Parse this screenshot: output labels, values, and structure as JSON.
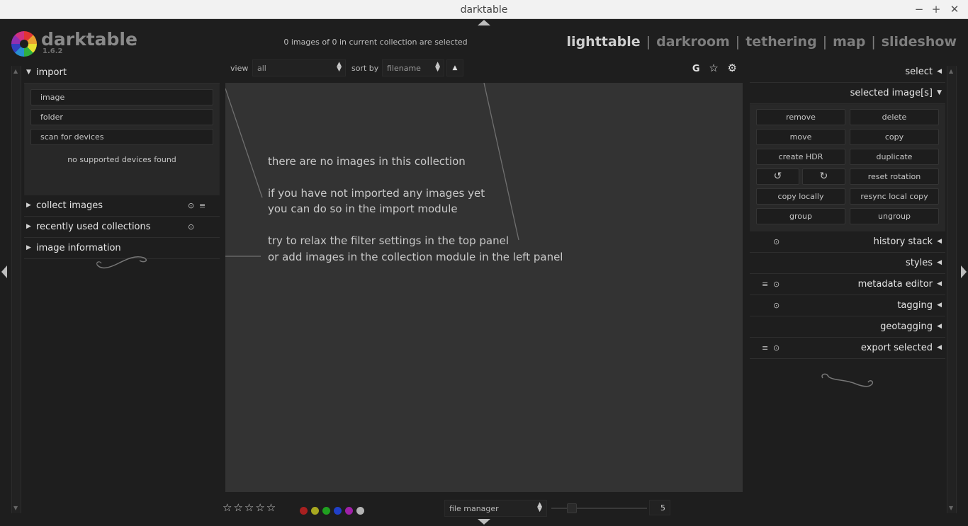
{
  "window": {
    "title": "darktable",
    "minimize": "−",
    "maximize": "+",
    "close": "✕"
  },
  "header": {
    "app_name": "darktable",
    "version": "1.6.2",
    "selection_info": "0 images of 0 in current collection are selected",
    "views": [
      "lighttable",
      "darkroom",
      "tethering",
      "map",
      "slideshow"
    ],
    "view_separator": "|",
    "active_view": "lighttable"
  },
  "left_panel": {
    "import": {
      "label": "import",
      "buttons": [
        "image",
        "folder",
        "scan for devices"
      ],
      "status": "no supported devices found"
    },
    "modules": [
      {
        "label": "collect images",
        "icons": [
          "⊙",
          "≡"
        ]
      },
      {
        "label": "recently used collections",
        "icons": [
          "⊙"
        ]
      },
      {
        "label": "image information",
        "icons": []
      }
    ]
  },
  "top_bar": {
    "view_label": "view",
    "view_value": "all",
    "sort_label": "sort by",
    "sort_value": "filename",
    "sort_direction": "▲",
    "icons": {
      "grouping": "G",
      "overlays": "☆",
      "preferences": "⚙"
    }
  },
  "center": {
    "messages": [
      "there are no images in this collection",
      "if you have not imported any images yet",
      "you can do so in the import module",
      "try to relax the filter settings in the top panel",
      "or add images in the collection module in the left panel"
    ]
  },
  "bottom_bar": {
    "stars": "☆☆☆☆☆",
    "color_labels": [
      "#a82020",
      "#a8a820",
      "#20a020",
      "#2040c8",
      "#a020a8",
      "#b4b4b4"
    ],
    "layout_value": "file manager",
    "zoom_value": "5"
  },
  "right_panel": {
    "select": {
      "label": "select"
    },
    "selected_images": {
      "label": "selected image[s]",
      "buttons": {
        "remove": "remove",
        "delete": "delete",
        "move": "move",
        "copy": "copy",
        "create_hdr": "create HDR",
        "duplicate": "duplicate",
        "rotate_left": "↺",
        "rotate_right": "↻",
        "reset_rotation": "reset rotation",
        "copy_locally": "copy locally",
        "resync_local_copy": "resync local copy",
        "group": "group",
        "ungroup": "ungroup"
      }
    },
    "modules": [
      {
        "label": "history stack",
        "icons": [
          "⊙"
        ]
      },
      {
        "label": "styles",
        "icons": []
      },
      {
        "label": "metadata editor",
        "icons": [
          "≡",
          "⊙"
        ]
      },
      {
        "label": "tagging",
        "icons": [
          "⊙"
        ]
      },
      {
        "label": "geotagging",
        "icons": []
      },
      {
        "label": "export selected",
        "icons": [
          "≡",
          "⊙"
        ]
      }
    ]
  }
}
